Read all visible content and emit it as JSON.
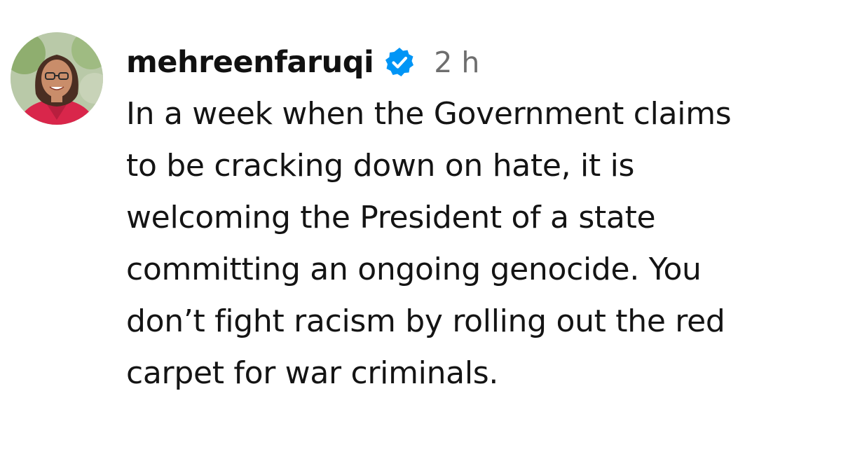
{
  "post": {
    "username": "mehreenfaruqi",
    "verified": true,
    "verified_icon": "verified-badge-icon",
    "timestamp": "2 h",
    "lines": [
      "In a week when the Government claims",
      "to be cracking down on hate, it is",
      "welcoming the President of a state",
      "committing an ongoing genocide. You",
      "don’t fight racism by rolling out the red",
      "carpet for war criminals."
    ]
  },
  "colors": {
    "verified_blue": "#0095f6",
    "timestamp_gray": "#6e6e6e",
    "text": "#141414"
  }
}
